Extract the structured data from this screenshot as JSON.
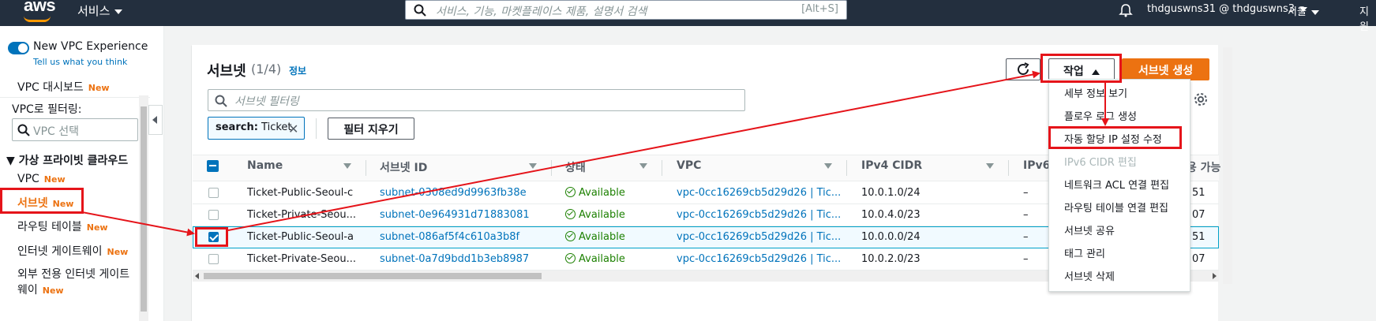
{
  "topnav": {
    "logo": "aws",
    "services_label": "서비스",
    "search_placeholder": "서비스, 기능, 마켓플레이스 제품, 설명서 검색",
    "search_shortcut": "[Alt+S]",
    "account": "thdguswns31 @ thdguswns3",
    "region": "서울",
    "support": "지원"
  },
  "sidebar": {
    "new_vpc_experience": "New VPC Experience",
    "tell_us": "Tell us what you think",
    "dashboard": "VPC 대시보드",
    "filter_label": "VPC로 필터링:",
    "vpc_select_placeholder": "VPC 선택",
    "section_title": "가상 프라이빗 클라우드",
    "items": [
      {
        "label": "VPC",
        "new": "New"
      },
      {
        "label": "서브넷",
        "new": "New"
      },
      {
        "label": "라우팅 테이블",
        "new": "New"
      },
      {
        "label": "인터넷 게이트웨이",
        "new": "New"
      },
      {
        "label": "외부 전용 인터넷 게이트",
        "new": ""
      },
      {
        "label": "웨이",
        "new": "New"
      }
    ],
    "new_badge": "New"
  },
  "main": {
    "title": "서브넷",
    "count": "(1/4)",
    "info": "정보",
    "actions_label": "작업",
    "create_label": "서브넷 생성",
    "filter_placeholder": "서브넷 필터링",
    "token_key": "search:",
    "token_value": "Ticket",
    "clear_filters": "필터 지우기",
    "columns": [
      "Name",
      "서브넷 ID",
      "상태",
      "VPC",
      "IPv4 CIDR",
      "IPv6",
      "사용 가능"
    ],
    "rows": [
      {
        "name": "Ticket-Public-Seoul-c",
        "subnet_id": "subnet-0308ed9d9963fb38e",
        "status": "Available",
        "vpc": "vpc-0cc16269cb5d29d26 | Tic...",
        "cidr": "10.0.1.0/24",
        "ipv6": "–",
        "avail": "51",
        "selected": false
      },
      {
        "name": "Ticket-Private-Seou...",
        "subnet_id": "subnet-0e964931d71883081",
        "status": "Available",
        "vpc": "vpc-0cc16269cb5d29d26 | Tic...",
        "cidr": "10.0.4.0/23",
        "ipv6": "–",
        "avail": "07",
        "selected": false
      },
      {
        "name": "Ticket-Public-Seoul-a",
        "subnet_id": "subnet-086af5f4c610a3b8f",
        "status": "Available",
        "vpc": "vpc-0cc16269cb5d29d26 | Tic...",
        "cidr": "10.0.0.0/24",
        "ipv6": "–",
        "avail": "51",
        "selected": true
      },
      {
        "name": "Ticket-Private-Seou...",
        "subnet_id": "subnet-0a7d9bdd1b3eb8987",
        "status": "Available",
        "vpc": "vpc-0cc16269cb5d29d26 | Tic...",
        "cidr": "10.0.2.0/23",
        "ipv6": "–",
        "avail": "07",
        "selected": false
      }
    ]
  },
  "actions_menu": {
    "items": [
      {
        "label": "세부 정보 보기",
        "disabled": false
      },
      {
        "label": "플로우 로그 생성",
        "disabled": false
      },
      {
        "label": "자동 할당 IP 설정 수정",
        "disabled": false
      },
      {
        "label": "IPv6 CIDR 편집",
        "disabled": true
      },
      {
        "label": "네트워크 ACL 연결 편집",
        "disabled": false
      },
      {
        "label": "라우팅 테이블 연결 편집",
        "disabled": false
      },
      {
        "label": "서브넷 공유",
        "disabled": false
      },
      {
        "label": "태그 관리",
        "disabled": false
      },
      {
        "label": "서브넷 삭제",
        "disabled": false
      }
    ]
  },
  "colors": {
    "nav_bg": "#232f3e",
    "accent": "#ec7211",
    "link": "#0073bb",
    "success": "#1d8102",
    "annotation": "#e5141a"
  }
}
